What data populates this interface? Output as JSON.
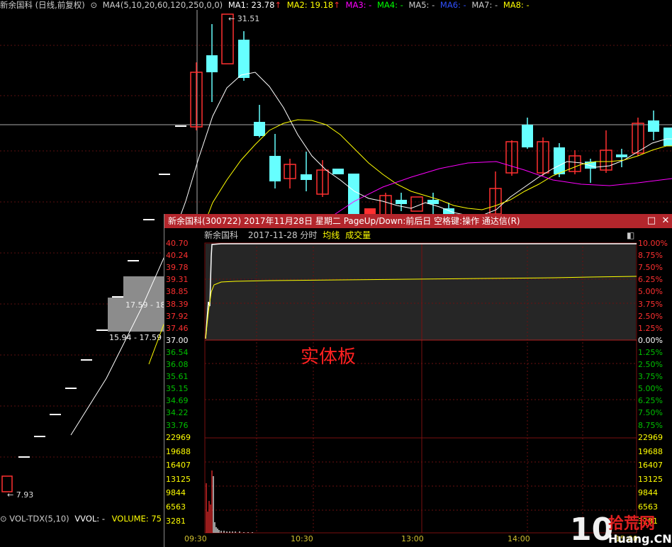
{
  "kline": {
    "header": {
      "title": "新余国科 (日线,前复权)",
      "ma_settings": "MA4(5,10,20,60,120,250,0,0)",
      "ma1": "MA1: 23.78",
      "ma2": "MA2: 19.18",
      "ma3": "MA3: -",
      "ma4": "MA4: -",
      "ma5": "MA5: -",
      "ma6": "MA6: -",
      "ma7": "MA7: -",
      "ma8": "MA8: -",
      "ma_colors": {
        "ma1": "#ffffff",
        "ma2": "#ffff00",
        "ma3": "#ff00ff",
        "ma4": "#00ff00",
        "ma5": "#c0c0c0",
        "ma6": "#0000ff",
        "ma7": "#c0c0c0",
        "ma8": "#ffff00"
      }
    },
    "high_label": "31.51",
    "low_label": "7.93",
    "price_boxes": [
      "17.59 - 18",
      "15.94 - 17.59"
    ]
  },
  "volume_header": {
    "name": "VOL-TDX(5,10)",
    "vvol": "VVOL: -",
    "volume": "VOLUME: 75"
  },
  "popup": {
    "title": "新余国科(300722) 2017年11月28日 星期二 PageUp/Down:前后日 空格键:操作 通达信(R)",
    "subheader": {
      "name": "新余国科",
      "date_label": "2017-11-28 分时",
      "avg_label": "均线",
      "vol_label": "成交量"
    },
    "annotation": "实体板",
    "price_labels": [
      "40.70",
      "40.24",
      "39.78",
      "39.31",
      "38.85",
      "38.39",
      "37.92",
      "37.46",
      "37.00",
      "36.54",
      "36.08",
      "35.61",
      "35.15",
      "34.69",
      "34.22",
      "33.76"
    ],
    "pct_labels": [
      "10.00%",
      "8.75%",
      "7.50%",
      "6.25%",
      "5.00%",
      "3.75%",
      "2.50%",
      "1.25%",
      "0.00%",
      "1.25%",
      "2.50%",
      "3.75%",
      "5.00%",
      "6.25%",
      "7.50%",
      "8.75%"
    ],
    "volume_labels": [
      "22969",
      "19688",
      "16407",
      "13125",
      "9844",
      "6563",
      "3281"
    ],
    "time_labels": [
      "09:30",
      "10:30",
      "13:00",
      "14:00",
      "15:00"
    ],
    "colors": {
      "up": "#ff3030",
      "down": "#00c000",
      "base": "#ffffff",
      "avg": "#ffff00"
    }
  },
  "watermark": {
    "text_top": "拾荒网",
    "text_bottom": "Huang.CN",
    "number": "10"
  }
}
